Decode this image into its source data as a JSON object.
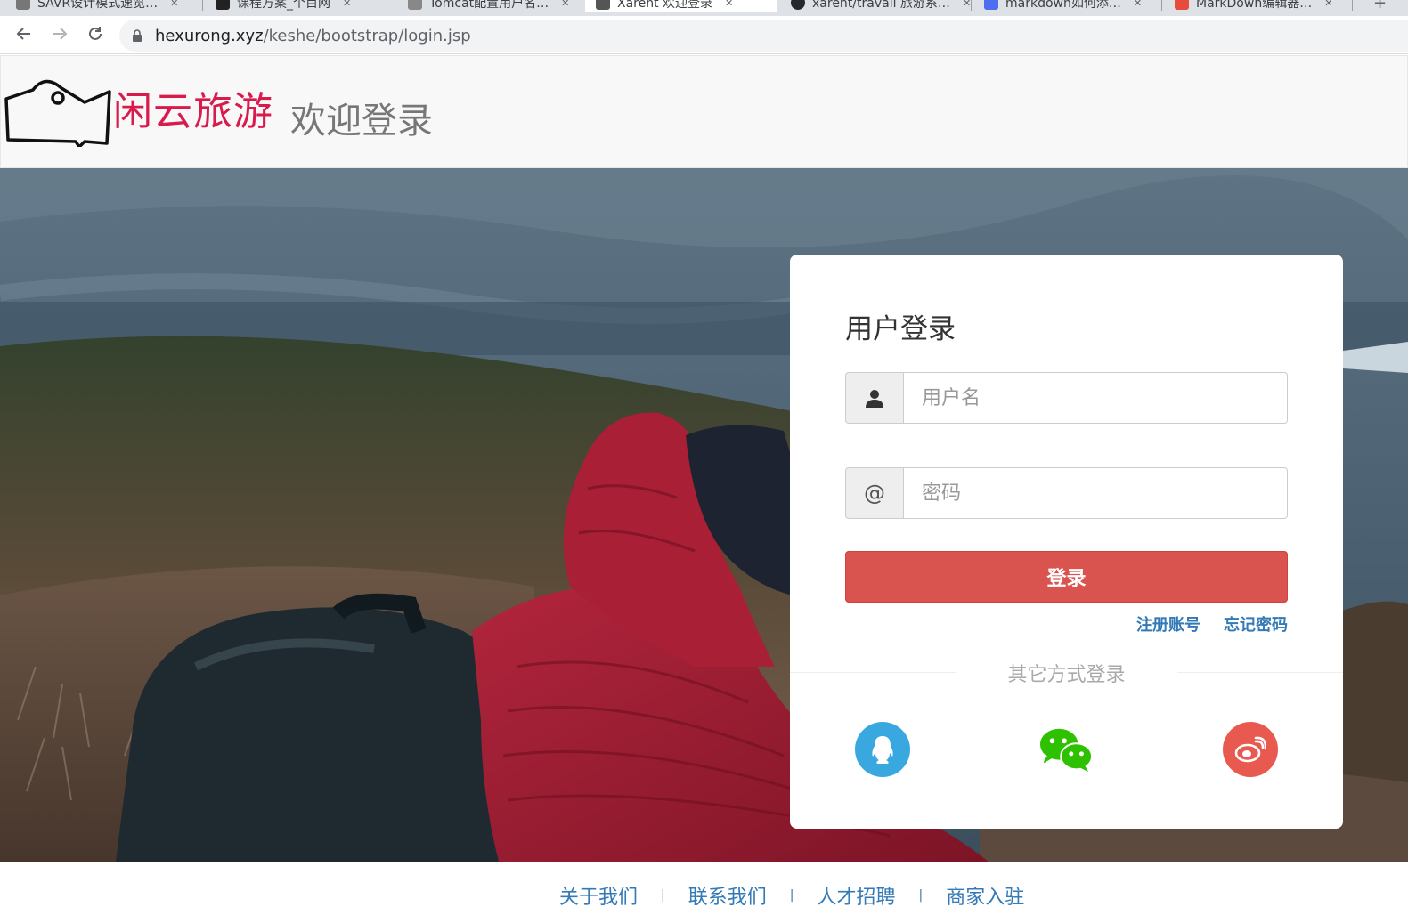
{
  "browser": {
    "tabs": [
      {
        "label": "SAVR设计模式速览…",
        "favicon_color": "#777777"
      },
      {
        "label": "课程方案_个目网",
        "favicon_color": "#222222"
      },
      {
        "label": "Tomcat配置用户名…",
        "favicon_color": "#888888"
      },
      {
        "label": "Xarent 欢迎登录",
        "favicon_color": "#555555"
      },
      {
        "label": "xarent/travail 旅游系…",
        "favicon_color": "#24292e"
      },
      {
        "label": "markdown如何添…",
        "favicon_color": "#4e6ef2"
      },
      {
        "label": "MarkDown编辑器…",
        "favicon_color": "#e84b3c"
      }
    ],
    "url_host": "hexurong.xyz",
    "url_path": "/keshe/bootstrap/login.jsp"
  },
  "header": {
    "brand": "闲云旅游",
    "title": "欢迎登录"
  },
  "login": {
    "title": "用户登录",
    "username_placeholder": "用户名",
    "password_placeholder": "密码",
    "password_addon": "@",
    "submit_label": "登录",
    "register_link": "注册账号",
    "forgot_link": "忘记密码",
    "other_methods": "其它方式登录",
    "social": [
      {
        "name": "qq",
        "color": "#3aa8e0"
      },
      {
        "name": "wechat",
        "color": "#2dc100"
      },
      {
        "name": "weibo",
        "color": "#e8594f"
      }
    ]
  },
  "footer": {
    "links": [
      "关于我们",
      "联系我们",
      "人才招聘",
      "商家入驻"
    ],
    "separator": "|"
  }
}
